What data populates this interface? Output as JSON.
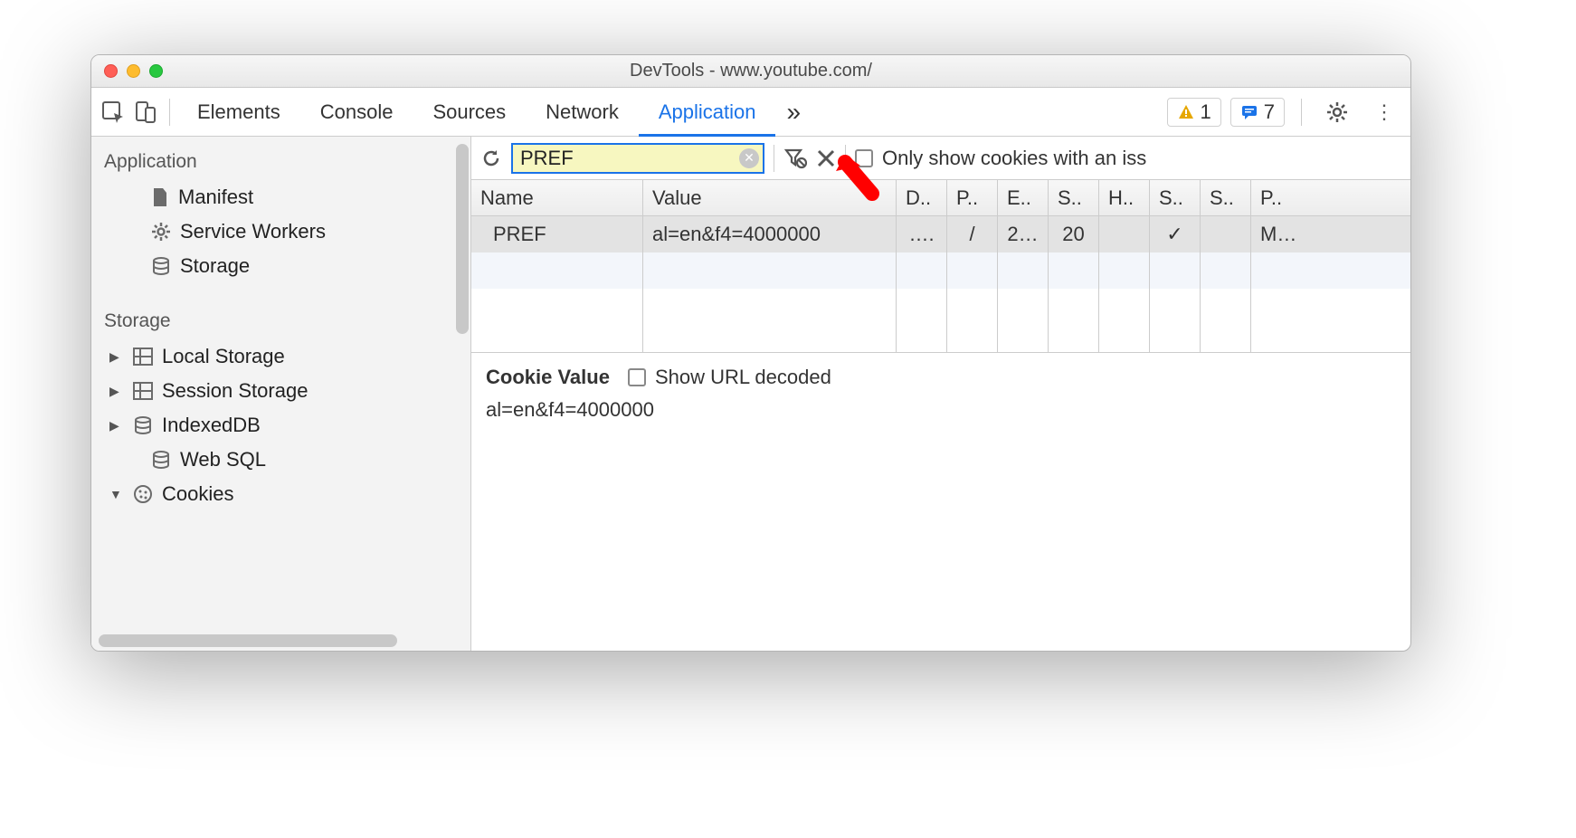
{
  "window": {
    "title": "DevTools - www.youtube.com/"
  },
  "toolbar": {
    "tabs": [
      "Elements",
      "Console",
      "Sources",
      "Network",
      "Application"
    ],
    "active_tab": "Application",
    "more": "»",
    "warnings_count": "1",
    "messages_count": "7"
  },
  "sidebar": {
    "application": {
      "label": "Application",
      "items": [
        "Manifest",
        "Service Workers",
        "Storage"
      ]
    },
    "storage": {
      "label": "Storage",
      "items": [
        "Local Storage",
        "Session Storage",
        "IndexedDB",
        "Web SQL",
        "Cookies"
      ]
    }
  },
  "filterbar": {
    "value": "PREF",
    "only_label": "Only show cookies with an iss"
  },
  "table": {
    "headers": [
      "Name",
      "Value",
      "D..",
      "P..",
      "E..",
      "S..",
      "H..",
      "S..",
      "S..",
      "P.."
    ],
    "row": {
      "name": "PREF",
      "value": "al=en&f4=4000000",
      "d": "….",
      "p": "/",
      "e": "2…",
      "s": "20",
      "h": "",
      "s2": "✓",
      "s3": "",
      "p2": "M…"
    }
  },
  "detail": {
    "title": "Cookie Value",
    "show_decoded_label": "Show URL decoded",
    "value": "al=en&f4=4000000"
  }
}
